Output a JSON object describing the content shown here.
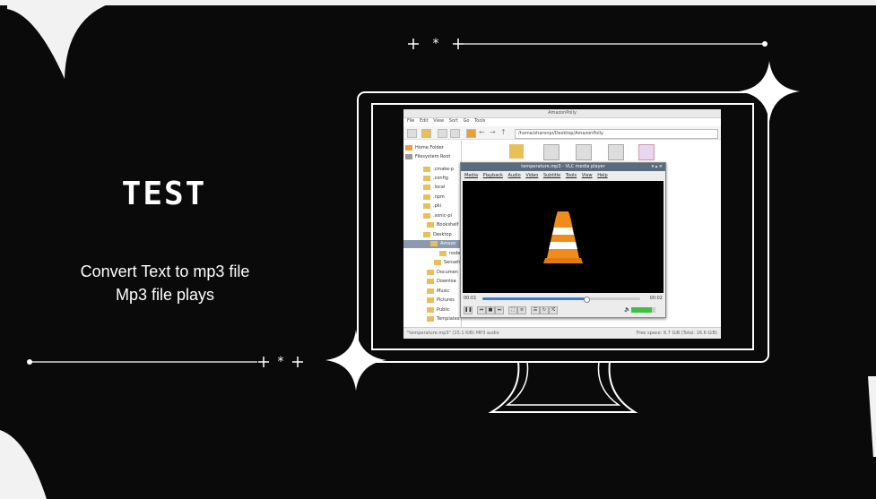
{
  "slide": {
    "title": "TEST",
    "lines": [
      "Convert Text to mp3 file",
      "Mp3 file plays"
    ],
    "colors": {
      "background": "#0a0a0a",
      "accent": "#ffffff"
    }
  },
  "file_manager": {
    "window_title": "AmazonPolly",
    "menu": [
      "File",
      "Edit",
      "View",
      "Sort",
      "Go",
      "Tools"
    ],
    "path": "/home/sharonpi/Desktop/AmazonPolly",
    "sidebar": [
      "Home Folder",
      "Filesystem Root",
      ".cmake-p",
      ".config",
      ".local",
      ".npm",
      ".pki",
      ".sonic-pi",
      "Bookshelf",
      "Desktop",
      "Amazo",
      "node",
      "Senseh",
      "Documen",
      "Downloa",
      "Music",
      "Pictures",
      "Public",
      "Templates"
    ],
    "status_left": "\"temperature.mp3\" (15.1 KiB) MP3 audio",
    "status_right": "Free space: 8.7 GiB (Total: 16.6 GiB)"
  },
  "vlc": {
    "window_title": "temperature.mp3 - VLC media player",
    "menu": [
      "Media",
      "Playback",
      "Audio",
      "Video",
      "Subtitle",
      "Tools",
      "View",
      "Help"
    ],
    "time_elapsed": "00:01",
    "time_total": "00:02",
    "progress": 0.66,
    "volume": 0.85
  }
}
